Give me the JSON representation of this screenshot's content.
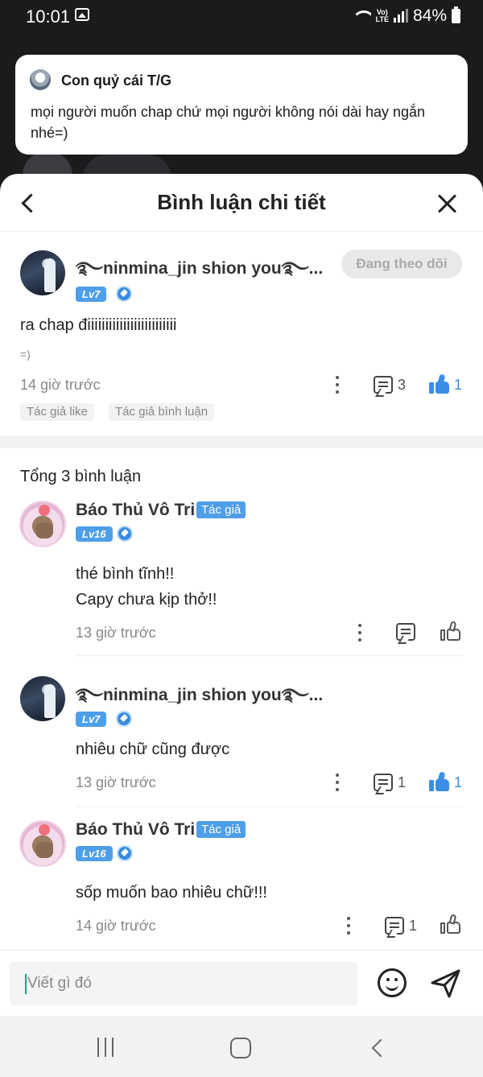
{
  "status_bar": {
    "time": "10:01",
    "network": "VoLTE",
    "battery": "84%"
  },
  "notification": {
    "title": "Con quỷ cái T/G",
    "text": "mọi người muốn chap chứ mọi người không nói dài hay ngắn nhé=)"
  },
  "sheet": {
    "title": "Bình luận chi tiết"
  },
  "main_comment": {
    "username": "࿐ninmina_jin shion you࿐...",
    "level": "Lv7",
    "follow_label": "Đang theo dõi",
    "text": "ra chap điiiiiiiiiiiiiiiiiiiiiiiii",
    "sub_text": "=)",
    "time": "14 giờ trước",
    "comment_count": "3",
    "like_count": "1",
    "tags": [
      "Tác giả like",
      "Tác giả bình luận"
    ]
  },
  "replies_header": "Tổng 3 bình luận",
  "replies": [
    {
      "username": "Báo Thủ Vô Tri",
      "author_tag": "Tác giả",
      "level": "Lv16",
      "line1": "thé bình tĩnh!!",
      "line2": "Capy chưa kịp thở!!",
      "time": "13 giờ trước"
    },
    {
      "username": "࿐ninmina_jin shion you࿐...",
      "level": "Lv7",
      "line1": "nhiêu chữ cũng được",
      "time": "13 giờ trước",
      "comment_count": "1",
      "like_count": "1"
    },
    {
      "username": "Báo Thủ Vô Tri",
      "author_tag": "Tác giả",
      "level": "Lv16",
      "line1": "sốp muốn bao nhiêu chữ!!!",
      "time": "14 giờ trước",
      "comment_count": "1"
    }
  ],
  "input": {
    "placeholder": "Viết gì đó"
  },
  "colors": {
    "accent": "#4e9fe8",
    "like_active": "#3b8ee6"
  }
}
